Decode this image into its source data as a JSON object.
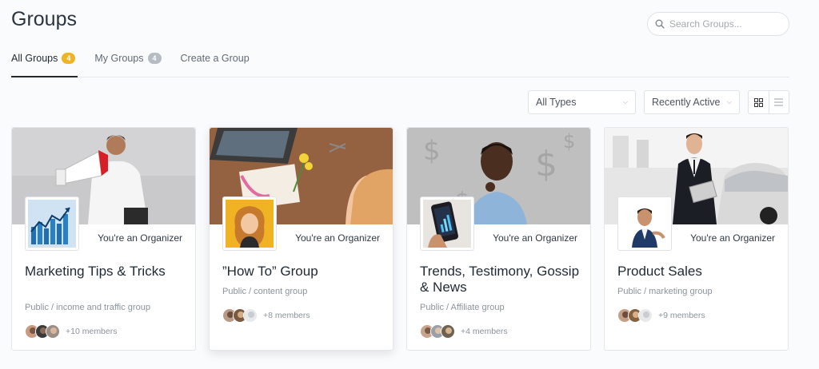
{
  "header": {
    "title": "Groups"
  },
  "search": {
    "placeholder": "Search Groups..."
  },
  "tabs": [
    {
      "label": "All Groups",
      "badge": "4"
    },
    {
      "label": "My Groups",
      "badge": "4"
    },
    {
      "label": "Create a Group"
    }
  ],
  "filters": {
    "type": "All Types",
    "order": "Recently Active"
  },
  "groups": [
    {
      "role": "You're an Organizer",
      "name": "Marketing Tips & Tricks",
      "meta": "Public / income and traffic group",
      "members": "+10 members"
    },
    {
      "role": "You're an Organizer",
      "name": "”How To” Group",
      "meta": "Public / content group",
      "members": "+8 members"
    },
    {
      "role": "You're an Organizer",
      "name": "Trends, Testimony, Gossip & News",
      "meta": "Public / Affiliate group",
      "members": "+4 members"
    },
    {
      "role": "You're an Organizer",
      "name": "Product Sales",
      "meta": "Public / marketing group",
      "members": "+9 members"
    }
  ],
  "colors": {
    "accent_badge": "#f0b323",
    "text_dark": "#1f2933",
    "muted": "#8a939c"
  }
}
